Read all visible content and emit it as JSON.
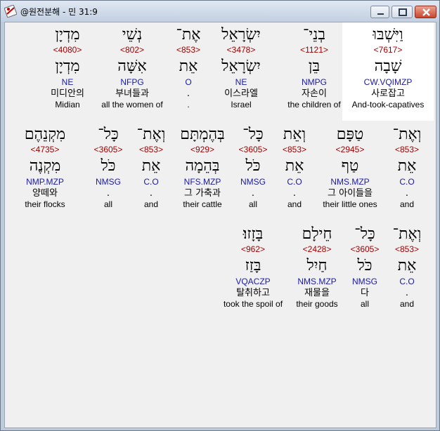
{
  "window": {
    "title": "@원전분해 - 민 31:9",
    "app_icon": "bible-app-icon",
    "controls": [
      "minimize-icon",
      "maximize-icon",
      "close-icon"
    ]
  },
  "rows": [
    {
      "words": [
        {
          "heb": "וַיִּשְׁבּוּ",
          "strong": "<7617>",
          "lemma": "שָׁבָה",
          "morph": "CW.VQIMZP",
          "kor": "사로잡고",
          "eng": "And-took-capatives",
          "highlight": true
        },
        {
          "heb": "בְנֵי־",
          "strong": "<1121>",
          "lemma": "בֵּן",
          "morph": "NMPG",
          "kor": "자손이",
          "eng": "the children of"
        },
        {
          "heb": "יִשְׂרָאֵל",
          "strong": "<3478>",
          "lemma": "יִשְׂרָאֵל",
          "morph": "NE",
          "kor": "이스라엘",
          "eng": "Israel"
        },
        {
          "heb": "אֶת־",
          "strong": "<853>",
          "lemma": "אֵת",
          "morph": "O",
          "kor": ".",
          "eng": "."
        },
        {
          "heb": "נְשֵׁי",
          "strong": "<802>",
          "lemma": "אִשָּׁה",
          "morph": "NFPG",
          "kor": "부녀들과",
          "eng": "all the women of"
        },
        {
          "heb": "מִדְיָן",
          "strong": "<4080>",
          "lemma": "מִדְיָן",
          "morph": "NE",
          "kor": "미디안의",
          "eng": "Midian"
        }
      ]
    },
    {
      "words": [
        {
          "heb": "וְאֶת־",
          "strong": "<853>",
          "lemma": "אֵת",
          "morph": "C.O",
          "kor": ".",
          "eng": "and"
        },
        {
          "heb": "טַפָּם",
          "strong": "<2945>",
          "lemma": "טַף",
          "morph": "NMS.MZP",
          "kor": "그 아이들을",
          "eng": "their little ones"
        },
        {
          "heb": "וְאֵת",
          "strong": "<853>",
          "lemma": "אֵת",
          "morph": "C.O",
          "kor": ".",
          "eng": "and"
        },
        {
          "heb": "כָּל־",
          "strong": "<3605>",
          "lemma": "כֹּל",
          "morph": "NMSG",
          "kor": ".",
          "eng": "all"
        },
        {
          "heb": "בְּהֶמְתָּם",
          "strong": "<929>",
          "lemma": "בְּהֵמָה",
          "morph": "NFS.MZP",
          "kor": "그 가축과",
          "eng": "their cattle"
        },
        {
          "heb": "וְאֶת־",
          "strong": "<853>",
          "lemma": "אֵת",
          "morph": "C.O",
          "kor": ".",
          "eng": "and"
        },
        {
          "heb": "כָּל־",
          "strong": "<3605>",
          "lemma": "כֹּל",
          "morph": "NMSG",
          "kor": ".",
          "eng": "all"
        },
        {
          "heb": "מִקְנֵהֶם",
          "strong": "<4735>",
          "lemma": "מִקְנֶה",
          "morph": "NMP.MZP",
          "kor": "양떼와",
          "eng": "their flocks"
        }
      ]
    },
    {
      "words": [
        {
          "heb": "וְאֶת־",
          "strong": "<853>",
          "lemma": "אֵת",
          "morph": "C.O",
          "kor": ".",
          "eng": "and"
        },
        {
          "heb": "כָּל־",
          "strong": "<3605>",
          "lemma": "כֹּל",
          "morph": "NMSG",
          "kor": "다",
          "eng": "all"
        },
        {
          "heb": "חֵילָם",
          "strong": "<2428>",
          "lemma": "חַיִל",
          "morph": "NMS.MZP",
          "kor": "재물을",
          "eng": "their goods"
        },
        {
          "heb": "בָּזָזוּ׃",
          "strong": "<962>",
          "lemma": "בָּזַז",
          "morph": "VQACZP",
          "kor": "탈취하고",
          "eng": "took the spoil of"
        }
      ]
    }
  ]
}
